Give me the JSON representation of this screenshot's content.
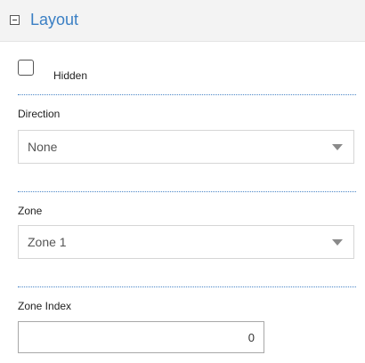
{
  "section": {
    "title": "Layout",
    "collapse_icon": "minus-box-icon"
  },
  "hidden": {
    "label": "Hidden",
    "checked": false
  },
  "direction": {
    "label": "Direction",
    "value": "None",
    "caret_icon": "chevron-down-icon"
  },
  "zone": {
    "label": "Zone",
    "value": "Zone 1",
    "caret_icon": "chevron-down-icon"
  },
  "zone_index": {
    "label": "Zone Index",
    "value": "0"
  },
  "colors": {
    "accent": "#3a7fc4",
    "header_bg": "#f3f3f3",
    "divider": "#4a86c7"
  }
}
